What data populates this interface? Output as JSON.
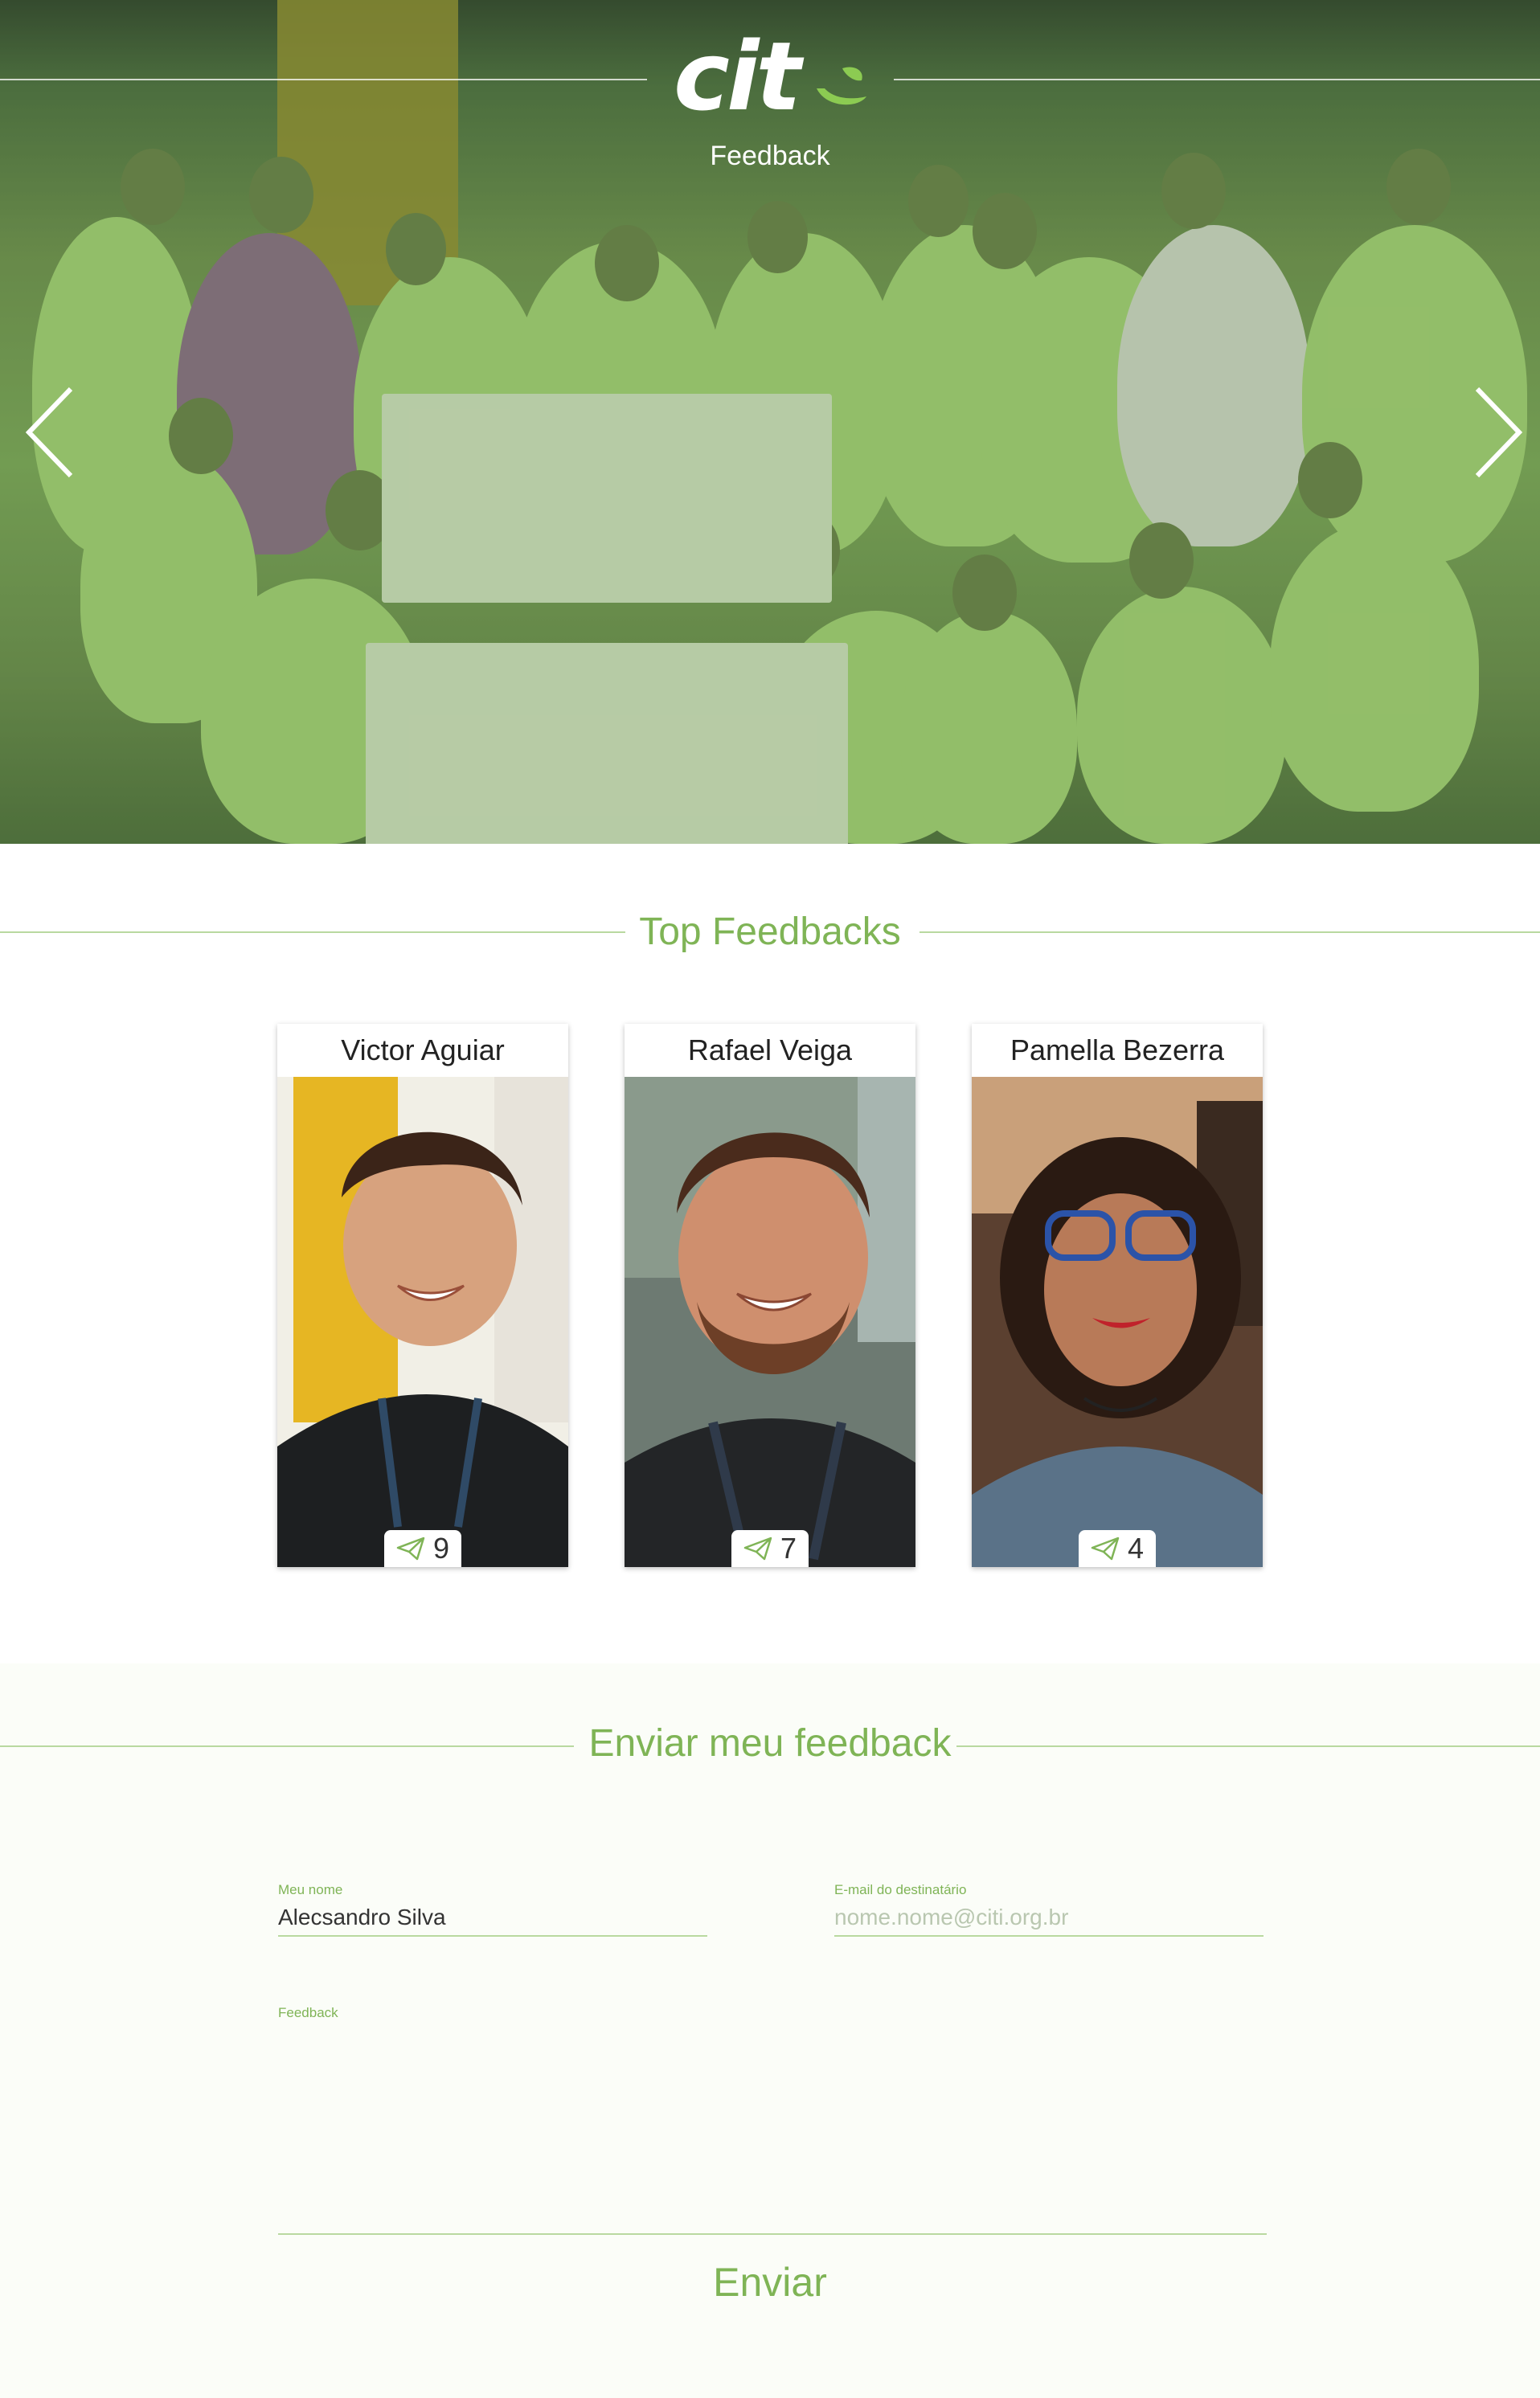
{
  "brand": {
    "logo_text": "cit",
    "subtitle": "Feedback"
  },
  "colors": {
    "accent": "#7fb456",
    "accent_light": "#b9d9a0",
    "hero_tint": "#6f8f4e",
    "form_bg": "#fbfdf8"
  },
  "hero": {
    "prev_icon": "chevron-left-icon",
    "next_icon": "chevron-right-icon"
  },
  "top_feedbacks": {
    "title": "Top Feedbacks",
    "cards": [
      {
        "name": "Victor Aguiar",
        "count": "9",
        "icon": "paper-plane-icon"
      },
      {
        "name": "Rafael Veiga",
        "count": "7",
        "icon": "paper-plane-icon"
      },
      {
        "name": "Pamella Bezerra",
        "count": "4",
        "icon": "paper-plane-icon"
      }
    ]
  },
  "form": {
    "title": "Enviar meu feedback",
    "name_label": "Meu nome",
    "name_value": "Alecsandro Silva",
    "email_label": "E-mail do destinatário",
    "email_placeholder": "nome.nome@citi.org.br",
    "feedback_label": "Feedback",
    "submit_label": "Enviar"
  }
}
